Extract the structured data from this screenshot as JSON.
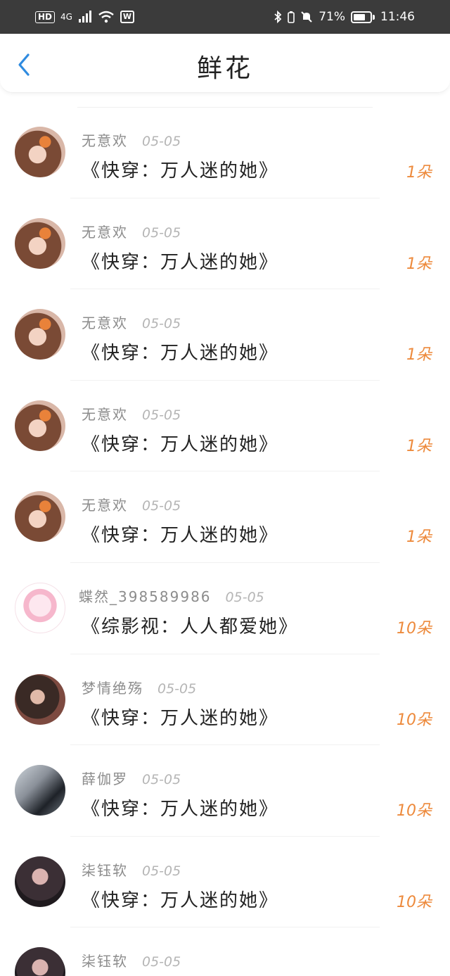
{
  "status_bar": {
    "network": "HD",
    "signal": "4G",
    "battery_percent": "71%",
    "battery_level": 0.71,
    "time": "11:46",
    "icons": [
      "bluetooth-icon",
      "mute-icon",
      "wifi-icon",
      "wps-icon"
    ]
  },
  "nav": {
    "title": "鲜花",
    "back_icon": "chevron-left-icon"
  },
  "colors": {
    "accent": "#ed8a3c",
    "back": "#2f8be0"
  },
  "records": [
    {
      "user": "无意欢",
      "date": "05-05",
      "book": "《快穿：万人迷的她》",
      "amount": "1朵"
    },
    {
      "user": "无意欢",
      "date": "05-05",
      "book": "《快穿：万人迷的她》",
      "amount": "1朵"
    },
    {
      "user": "无意欢",
      "date": "05-05",
      "book": "《快穿：万人迷的她》",
      "amount": "1朵"
    },
    {
      "user": "无意欢",
      "date": "05-05",
      "book": "《快穿：万人迷的她》",
      "amount": "1朵"
    },
    {
      "user": "无意欢",
      "date": "05-05",
      "book": "《快穿：万人迷的她》",
      "amount": "1朵"
    },
    {
      "user": "蝶然_398589986",
      "date": "05-05",
      "book": "《综影视：人人都爱她》",
      "amount": "10朵"
    },
    {
      "user": "梦情绝殇",
      "date": "05-05",
      "book": "《快穿：万人迷的她》",
      "amount": "10朵"
    },
    {
      "user": "薛伽罗",
      "date": "05-05",
      "book": "《快穿：万人迷的她》",
      "amount": "10朵"
    },
    {
      "user": "柒钰软",
      "date": "05-05",
      "book": "《快穿：万人迷的她》",
      "amount": "10朵"
    },
    {
      "user": "柒钰软",
      "date": "05-05"
    }
  ]
}
